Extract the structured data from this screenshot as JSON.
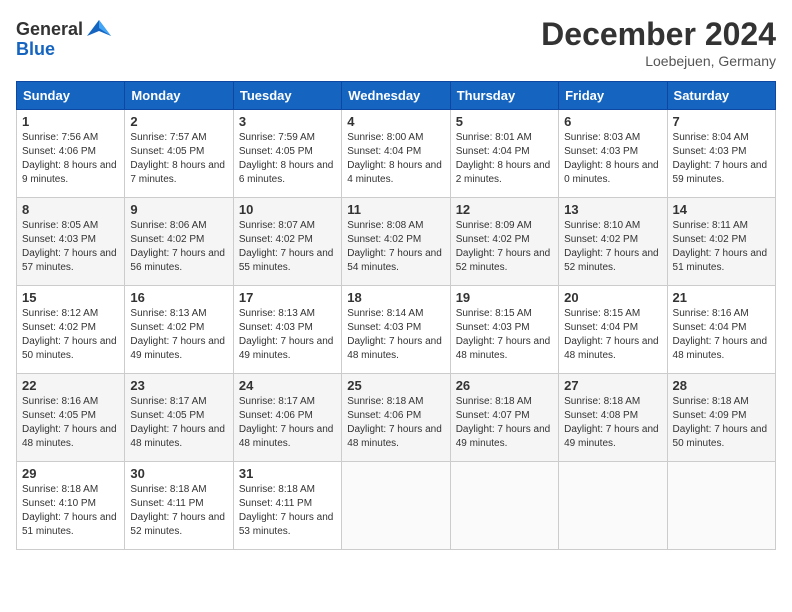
{
  "header": {
    "logo_general": "General",
    "logo_blue": "Blue",
    "month_title": "December 2024",
    "location": "Loebejuen, Germany"
  },
  "columns": [
    "Sunday",
    "Monday",
    "Tuesday",
    "Wednesday",
    "Thursday",
    "Friday",
    "Saturday"
  ],
  "weeks": [
    [
      {
        "day": "1",
        "sunrise": "7:56 AM",
        "sunset": "4:06 PM",
        "daylight": "8 hours and 9 minutes."
      },
      {
        "day": "2",
        "sunrise": "7:57 AM",
        "sunset": "4:05 PM",
        "daylight": "8 hours and 7 minutes."
      },
      {
        "day": "3",
        "sunrise": "7:59 AM",
        "sunset": "4:05 PM",
        "daylight": "8 hours and 6 minutes."
      },
      {
        "day": "4",
        "sunrise": "8:00 AM",
        "sunset": "4:04 PM",
        "daylight": "8 hours and 4 minutes."
      },
      {
        "day": "5",
        "sunrise": "8:01 AM",
        "sunset": "4:04 PM",
        "daylight": "8 hours and 2 minutes."
      },
      {
        "day": "6",
        "sunrise": "8:03 AM",
        "sunset": "4:03 PM",
        "daylight": "8 hours and 0 minutes."
      },
      {
        "day": "7",
        "sunrise": "8:04 AM",
        "sunset": "4:03 PM",
        "daylight": "7 hours and 59 minutes."
      }
    ],
    [
      {
        "day": "8",
        "sunrise": "8:05 AM",
        "sunset": "4:03 PM",
        "daylight": "7 hours and 57 minutes."
      },
      {
        "day": "9",
        "sunrise": "8:06 AM",
        "sunset": "4:02 PM",
        "daylight": "7 hours and 56 minutes."
      },
      {
        "day": "10",
        "sunrise": "8:07 AM",
        "sunset": "4:02 PM",
        "daylight": "7 hours and 55 minutes."
      },
      {
        "day": "11",
        "sunrise": "8:08 AM",
        "sunset": "4:02 PM",
        "daylight": "7 hours and 54 minutes."
      },
      {
        "day": "12",
        "sunrise": "8:09 AM",
        "sunset": "4:02 PM",
        "daylight": "7 hours and 52 minutes."
      },
      {
        "day": "13",
        "sunrise": "8:10 AM",
        "sunset": "4:02 PM",
        "daylight": "7 hours and 52 minutes."
      },
      {
        "day": "14",
        "sunrise": "8:11 AM",
        "sunset": "4:02 PM",
        "daylight": "7 hours and 51 minutes."
      }
    ],
    [
      {
        "day": "15",
        "sunrise": "8:12 AM",
        "sunset": "4:02 PM",
        "daylight": "7 hours and 50 minutes."
      },
      {
        "day": "16",
        "sunrise": "8:13 AM",
        "sunset": "4:02 PM",
        "daylight": "7 hours and 49 minutes."
      },
      {
        "day": "17",
        "sunrise": "8:13 AM",
        "sunset": "4:03 PM",
        "daylight": "7 hours and 49 minutes."
      },
      {
        "day": "18",
        "sunrise": "8:14 AM",
        "sunset": "4:03 PM",
        "daylight": "7 hours and 48 minutes."
      },
      {
        "day": "19",
        "sunrise": "8:15 AM",
        "sunset": "4:03 PM",
        "daylight": "7 hours and 48 minutes."
      },
      {
        "day": "20",
        "sunrise": "8:15 AM",
        "sunset": "4:04 PM",
        "daylight": "7 hours and 48 minutes."
      },
      {
        "day": "21",
        "sunrise": "8:16 AM",
        "sunset": "4:04 PM",
        "daylight": "7 hours and 48 minutes."
      }
    ],
    [
      {
        "day": "22",
        "sunrise": "8:16 AM",
        "sunset": "4:05 PM",
        "daylight": "7 hours and 48 minutes."
      },
      {
        "day": "23",
        "sunrise": "8:17 AM",
        "sunset": "4:05 PM",
        "daylight": "7 hours and 48 minutes."
      },
      {
        "day": "24",
        "sunrise": "8:17 AM",
        "sunset": "4:06 PM",
        "daylight": "7 hours and 48 minutes."
      },
      {
        "day": "25",
        "sunrise": "8:18 AM",
        "sunset": "4:06 PM",
        "daylight": "7 hours and 48 minutes."
      },
      {
        "day": "26",
        "sunrise": "8:18 AM",
        "sunset": "4:07 PM",
        "daylight": "7 hours and 49 minutes."
      },
      {
        "day": "27",
        "sunrise": "8:18 AM",
        "sunset": "4:08 PM",
        "daylight": "7 hours and 49 minutes."
      },
      {
        "day": "28",
        "sunrise": "8:18 AM",
        "sunset": "4:09 PM",
        "daylight": "7 hours and 50 minutes."
      }
    ],
    [
      {
        "day": "29",
        "sunrise": "8:18 AM",
        "sunset": "4:10 PM",
        "daylight": "7 hours and 51 minutes."
      },
      {
        "day": "30",
        "sunrise": "8:18 AM",
        "sunset": "4:11 PM",
        "daylight": "7 hours and 52 minutes."
      },
      {
        "day": "31",
        "sunrise": "8:18 AM",
        "sunset": "4:11 PM",
        "daylight": "7 hours and 53 minutes."
      },
      null,
      null,
      null,
      null
    ]
  ]
}
